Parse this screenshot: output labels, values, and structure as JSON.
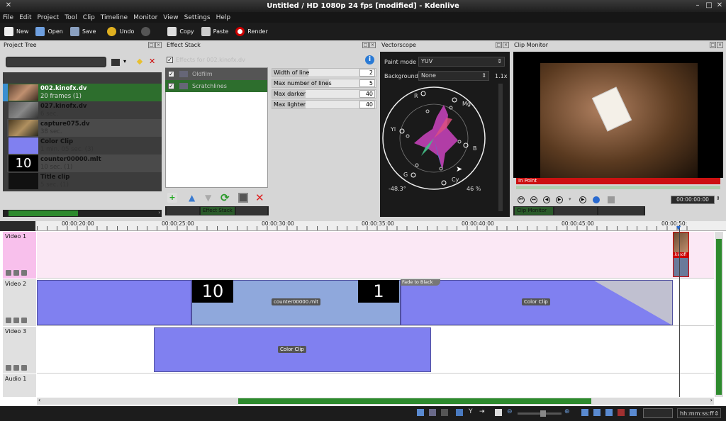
{
  "window": {
    "title": "Untitled / HD 1080p 24 fps [modified] - Kdenlive"
  },
  "menu": [
    "File",
    "Edit",
    "Project",
    "Tool",
    "Clip",
    "Timeline",
    "Monitor",
    "View",
    "Settings",
    "Help"
  ],
  "toolbar": {
    "new": "New",
    "open": "Open",
    "save": "Save",
    "undo": "Undo",
    "copy": "Copy",
    "paste": "Paste",
    "render": "Render"
  },
  "project_tree": {
    "title": "Project Tree",
    "items": [
      {
        "name": "002.kinofx.dv",
        "duration": "20 frames (1)"
      },
      {
        "name": "027.kinofx.dv",
        "duration": "6 sec."
      },
      {
        "name": "capture075.dv",
        "duration": "38 sec."
      },
      {
        "name": "Color Clip",
        "duration": "1 min. 05 sec. (3)"
      },
      {
        "name": "counter00000.mlt",
        "duration": "10 sec. (1)",
        "thumb_text": "10"
      },
      {
        "name": "Title clip",
        "duration": "5 sec. (1)"
      }
    ]
  },
  "effect_stack": {
    "title": "Effect Stack",
    "header": "Effects for 002.kinofx.dv",
    "effects": [
      "Oldfilm",
      "Scratchlines"
    ],
    "params": [
      {
        "label": "Width of line",
        "value": "2",
        "fill": 0.35
      },
      {
        "label": "Max number of lines",
        "value": "5",
        "fill": 0.55
      },
      {
        "label": "Max darker",
        "value": "40",
        "fill": 0.32
      },
      {
        "label": "Max lighter",
        "value": "40",
        "fill": 0.32
      }
    ],
    "tabs": [
      "",
      "Effect Stack",
      ""
    ]
  },
  "vectorscope": {
    "title": "Vectorscope",
    "paint_mode_label": "Paint mode",
    "paint_mode_value": "YUV",
    "background_label": "Background",
    "background_value": "None",
    "zoom": "1.1x",
    "angle": "-48.3°",
    "percent": "46 %",
    "labels": {
      "r": "R",
      "mg": "Mg",
      "yl": "Yl",
      "b": "B",
      "g": "G",
      "cy": "Cy"
    }
  },
  "clip_monitor": {
    "title": "Clip Monitor",
    "in_point": "In Point",
    "timecode": "00:00:00:00",
    "tabs": [
      "Clip Monitor",
      "",
      ""
    ]
  },
  "timeline": {
    "ruler": [
      "00:00:20:00",
      "00:00:25:00",
      "00:00:30:00",
      "00:00:35:00",
      "00:00:40:00",
      "00:00:45:00",
      "00:00:50:"
    ],
    "tracks": [
      "Video 1",
      "Video 2",
      "Video 3",
      "Audio 1"
    ],
    "clips": {
      "v1_small": ".kinofi",
      "counter_label": "counter00000.mlt",
      "counter_num_a": "10",
      "counter_num_b": "1",
      "fade_label": "Fade to Black",
      "color_clip_v2": "Color Clip",
      "color_clip_v3": "Color Clip"
    },
    "timecode_format": "hh:mm:ss:ff"
  },
  "colors": {
    "selected": "#2d6e2d",
    "clip_blue": "#8080f0",
    "clip_light": "#8fa8dc",
    "track_v1": "#fbe8f5",
    "in_point": "#cc1111"
  }
}
